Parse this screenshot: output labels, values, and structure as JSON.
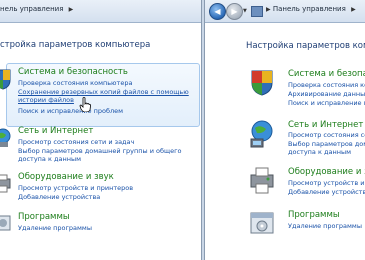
{
  "left": {
    "address": {
      "path": "нель управления"
    },
    "heading": "стройка параметров компьютера",
    "categories": [
      {
        "title": "Система и безопасность",
        "links": [
          "Проверка состояния компьютера",
          "Сохранение резервных копий файлов с помощью",
          "истории файлов",
          "Поиск и исправление проблем"
        ]
      },
      {
        "title": "Сеть и Интернет",
        "links": [
          "Просмотр состояния сети и задач",
          "Выбор параметров домашней группы и общего",
          "доступа к данным"
        ]
      },
      {
        "title": "Оборудование и звук",
        "links": [
          "Просмотр устройств и принтеров",
          "Добавление устройства"
        ]
      },
      {
        "title": "Программы",
        "links": [
          "Удаление программы"
        ]
      }
    ]
  },
  "right": {
    "address": {
      "path": "Панель управления"
    },
    "heading": "Настройка параметров компьютера",
    "categories": [
      {
        "title": "Система и безопас",
        "links": [
          "Проверка состояния компь",
          "Архивирование данных",
          "Поиск и исправление про"
        ]
      },
      {
        "title": "Сеть и Интернет",
        "links": [
          "Просмотр состояния се",
          "Выбор параметров дом",
          "доступа к данным"
        ]
      },
      {
        "title": "Оборудование и з",
        "links": [
          "Просмотр устройств и",
          "Добавление устройств"
        ]
      },
      {
        "title": "Программы",
        "links": [
          "Удаление программы"
        ]
      }
    ]
  },
  "colors": {
    "title_green": "#1c7d1a",
    "link_blue": "#1a52a8",
    "heading_blue": "#1f3e74"
  }
}
